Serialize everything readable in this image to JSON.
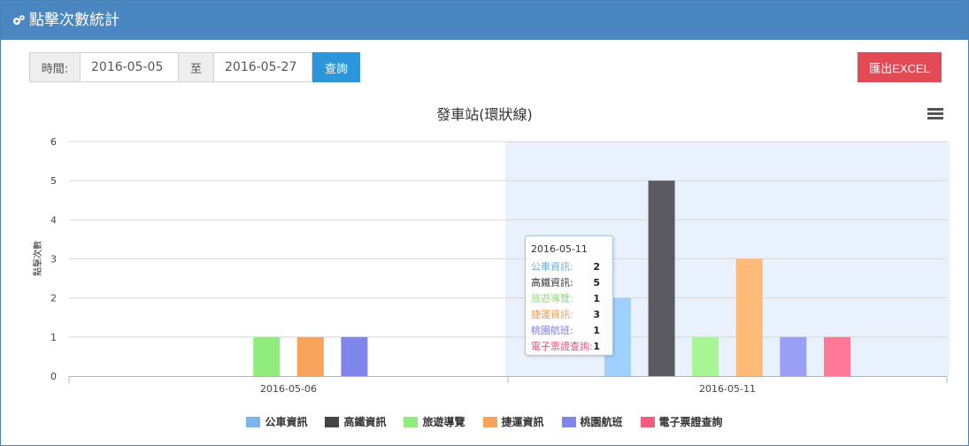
{
  "header": {
    "title": "點擊次數統計",
    "icon": "gears-icon"
  },
  "filter": {
    "time_label": "時間:",
    "start_date": "2016-05-05",
    "to_label": "至",
    "end_date": "2016-05-27",
    "query_button": "查詢"
  },
  "export_button": "匯出EXCEL",
  "colors": {
    "header": "#4a86bf",
    "query": "#2d95d9",
    "export": "#e24a55",
    "highlight": "#e8f1fc"
  },
  "tooltip": {
    "date": "2016-05-11",
    "rows": [
      {
        "label": "公車資訊:",
        "value": "2",
        "color": "#6aa9e0"
      },
      {
        "label": "高鐵資訊:",
        "value": "5",
        "color": "#333333"
      },
      {
        "label": "旅遊導覽:",
        "value": "1",
        "color": "#8ee07a"
      },
      {
        "label": "捷運資訊:",
        "value": "3",
        "color": "#f29a4a"
      },
      {
        "label": "桃園航班:",
        "value": "1",
        "color": "#7b7be0"
      },
      {
        "label": "電子票證查詢:",
        "value": "1",
        "color": "#e0507a"
      }
    ]
  },
  "chart_data": {
    "type": "bar",
    "title": "發車站(環狀線)",
    "xlabel": "",
    "ylabel": "點擊次數",
    "ylim": [
      0,
      6
    ],
    "yticks": [
      0,
      1,
      2,
      3,
      4,
      5,
      6
    ],
    "categories": [
      "2016-05-06",
      "2016-05-11"
    ],
    "highlighted_category": "2016-05-11",
    "grid": true,
    "legend_position": "bottom-center",
    "series": [
      {
        "name": "公車資訊",
        "values": [
          0,
          2
        ],
        "color": "#7cb5ec",
        "hover_color": "#9fd0ff"
      },
      {
        "name": "高鐵資訊",
        "values": [
          0,
          5
        ],
        "color": "#434348",
        "hover_color": "#5a5a60"
      },
      {
        "name": "旅遊導覽",
        "values": [
          1,
          1
        ],
        "color": "#90ed7d",
        "hover_color": "#a8f596"
      },
      {
        "name": "捷運資訊",
        "values": [
          1,
          3
        ],
        "color": "#f7a35c",
        "hover_color": "#ffba78"
      },
      {
        "name": "桃園航班",
        "values": [
          1,
          1
        ],
        "color": "#8085e9",
        "hover_color": "#9a9ff5"
      },
      {
        "name": "電子票證查詢",
        "values": [
          0,
          1
        ],
        "color": "#f15c80",
        "hover_color": "#ff7898"
      }
    ]
  }
}
